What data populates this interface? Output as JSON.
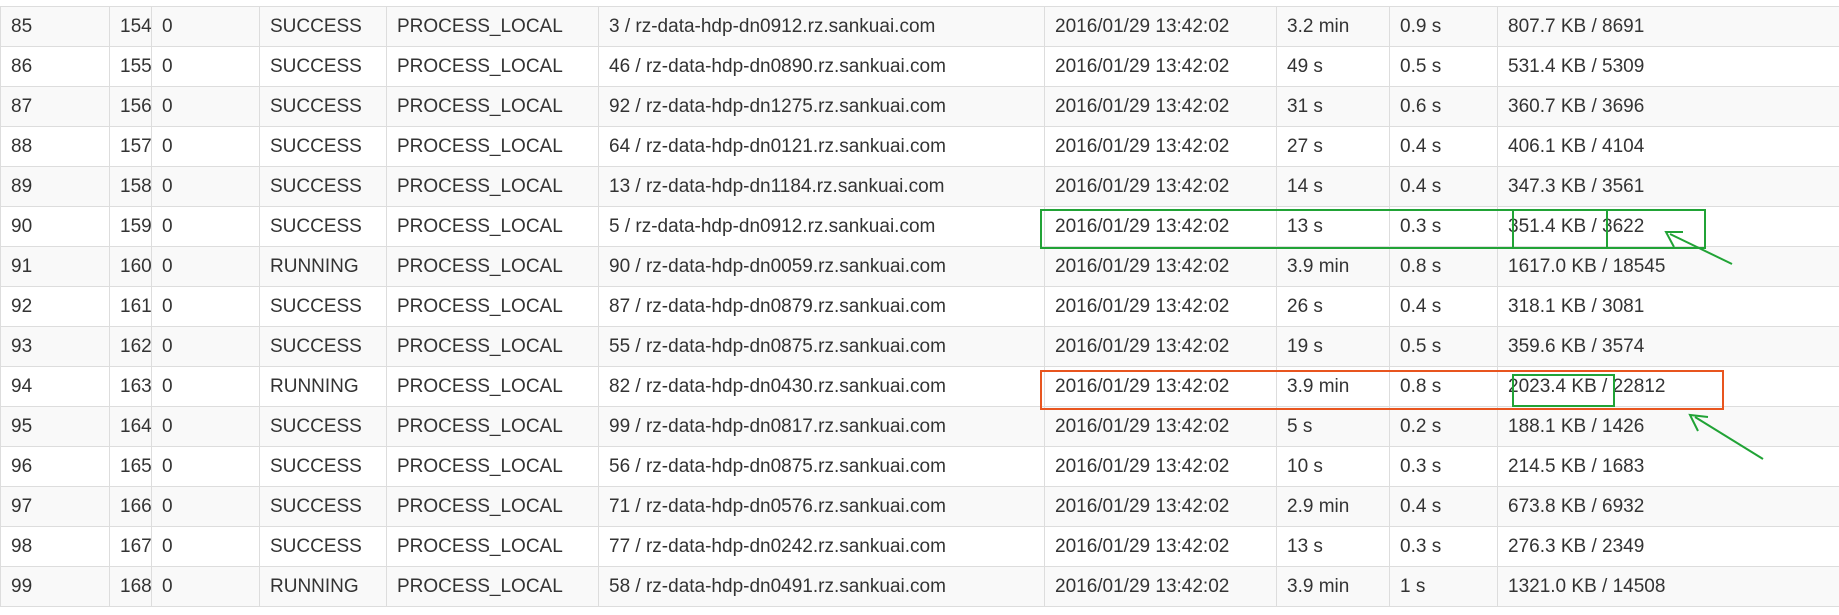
{
  "task_rows": [
    {
      "index": "85",
      "id": "154",
      "attempt": "0",
      "status": "SUCCESS",
      "locality": "PROCESS_LOCAL",
      "executor": "3 / rz-data-hdp-dn0912.rz.sankuai.com",
      "launch_time": "2016/01/29 13:42:02",
      "duration": "3.2 min",
      "gc_time": "0.9 s",
      "input_size": "807.7 KB",
      "input_sep": " / ",
      "input_records": "8691"
    },
    {
      "index": "86",
      "id": "155",
      "attempt": "0",
      "status": "SUCCESS",
      "locality": "PROCESS_LOCAL",
      "executor": "46 / rz-data-hdp-dn0890.rz.sankuai.com",
      "launch_time": "2016/01/29 13:42:02",
      "duration": "49 s",
      "gc_time": "0.5 s",
      "input_size": "531.4 KB",
      "input_sep": " / ",
      "input_records": "5309"
    },
    {
      "index": "87",
      "id": "156",
      "attempt": "0",
      "status": "SUCCESS",
      "locality": "PROCESS_LOCAL",
      "executor": "92 / rz-data-hdp-dn1275.rz.sankuai.com",
      "launch_time": "2016/01/29 13:42:02",
      "duration": "31 s",
      "gc_time": "0.6 s",
      "input_size": "360.7 KB",
      "input_sep": " / ",
      "input_records": "3696"
    },
    {
      "index": "88",
      "id": "157",
      "attempt": "0",
      "status": "SUCCESS",
      "locality": "PROCESS_LOCAL",
      "executor": "64 / rz-data-hdp-dn0121.rz.sankuai.com",
      "launch_time": "2016/01/29 13:42:02",
      "duration": "27 s",
      "gc_time": "0.4 s",
      "input_size": "406.1 KB",
      "input_sep": " / ",
      "input_records": "4104"
    },
    {
      "index": "89",
      "id": "158",
      "attempt": "0",
      "status": "SUCCESS",
      "locality": "PROCESS_LOCAL",
      "executor": "13 / rz-data-hdp-dn1184.rz.sankuai.com",
      "launch_time": "2016/01/29 13:42:02",
      "duration": "14 s",
      "gc_time": "0.4 s",
      "input_size": "347.3 KB",
      "input_sep": " / ",
      "input_records": "3561"
    },
    {
      "index": "90",
      "id": "159",
      "attempt": "0",
      "status": "SUCCESS",
      "locality": "PROCESS_LOCAL",
      "executor": "5 / rz-data-hdp-dn0912.rz.sankuai.com",
      "launch_time": "2016/01/29 13:42:02",
      "duration": "13 s",
      "gc_time": "0.3 s",
      "input_size": "351.4 KB",
      "input_sep": " / ",
      "input_records": "3622"
    },
    {
      "index": "91",
      "id": "160",
      "attempt": "0",
      "status": "RUNNING",
      "locality": "PROCESS_LOCAL",
      "executor": "90 / rz-data-hdp-dn0059.rz.sankuai.com",
      "launch_time": "2016/01/29 13:42:02",
      "duration": "3.9 min",
      "gc_time": "0.8 s",
      "input_size": "1617.0 KB",
      "input_sep": " / ",
      "input_records": "18545"
    },
    {
      "index": "92",
      "id": "161",
      "attempt": "0",
      "status": "SUCCESS",
      "locality": "PROCESS_LOCAL",
      "executor": "87 / rz-data-hdp-dn0879.rz.sankuai.com",
      "launch_time": "2016/01/29 13:42:02",
      "duration": "26 s",
      "gc_time": "0.4 s",
      "input_size": "318.1 KB",
      "input_sep": " / ",
      "input_records": "3081"
    },
    {
      "index": "93",
      "id": "162",
      "attempt": "0",
      "status": "SUCCESS",
      "locality": "PROCESS_LOCAL",
      "executor": "55 / rz-data-hdp-dn0875.rz.sankuai.com",
      "launch_time": "2016/01/29 13:42:02",
      "duration": "19 s",
      "gc_time": "0.5 s",
      "input_size": "359.6 KB",
      "input_sep": " / ",
      "input_records": "3574"
    },
    {
      "index": "94",
      "id": "163",
      "attempt": "0",
      "status": "RUNNING",
      "locality": "PROCESS_LOCAL",
      "executor": "82 / rz-data-hdp-dn0430.rz.sankuai.com",
      "launch_time": "2016/01/29 13:42:02",
      "duration": "3.9 min",
      "gc_time": "0.8 s",
      "input_size": "2023.4 KB",
      "input_sep": " / ",
      "input_records": "22812"
    },
    {
      "index": "95",
      "id": "164",
      "attempt": "0",
      "status": "SUCCESS",
      "locality": "PROCESS_LOCAL",
      "executor": "99 / rz-data-hdp-dn0817.rz.sankuai.com",
      "launch_time": "2016/01/29 13:42:02",
      "duration": "5 s",
      "gc_time": "0.2 s",
      "input_size": "188.1 KB",
      "input_sep": " / ",
      "input_records": "1426"
    },
    {
      "index": "96",
      "id": "165",
      "attempt": "0",
      "status": "SUCCESS",
      "locality": "PROCESS_LOCAL",
      "executor": "56 / rz-data-hdp-dn0875.rz.sankuai.com",
      "launch_time": "2016/01/29 13:42:02",
      "duration": "10 s",
      "gc_time": "0.3 s",
      "input_size": "214.5 KB",
      "input_sep": " / ",
      "input_records": "1683"
    },
    {
      "index": "97",
      "id": "166",
      "attempt": "0",
      "status": "SUCCESS",
      "locality": "PROCESS_LOCAL",
      "executor": "71 / rz-data-hdp-dn0576.rz.sankuai.com",
      "launch_time": "2016/01/29 13:42:02",
      "duration": "2.9 min",
      "gc_time": "0.4 s",
      "input_size": "673.8 KB",
      "input_sep": " / ",
      "input_records": "6932"
    },
    {
      "index": "98",
      "id": "167",
      "attempt": "0",
      "status": "SUCCESS",
      "locality": "PROCESS_LOCAL",
      "executor": "77 / rz-data-hdp-dn0242.rz.sankuai.com",
      "launch_time": "2016/01/29 13:42:02",
      "duration": "13 s",
      "gc_time": "0.3 s",
      "input_size": "276.3 KB",
      "input_sep": " / ",
      "input_records": "2349"
    },
    {
      "index": "99",
      "id": "168",
      "attempt": "0",
      "status": "RUNNING",
      "locality": "PROCESS_LOCAL",
      "executor": "58 / rz-data-hdp-dn0491.rz.sankuai.com",
      "launch_time": "2016/01/29 13:42:02",
      "duration": "3.9 min",
      "gc_time": "1 s",
      "input_size": "1321.0 KB",
      "input_sep": " / ",
      "input_records": "14508"
    }
  ],
  "annotation_colors": {
    "green": "#21a336",
    "orange": "#e8551f"
  }
}
